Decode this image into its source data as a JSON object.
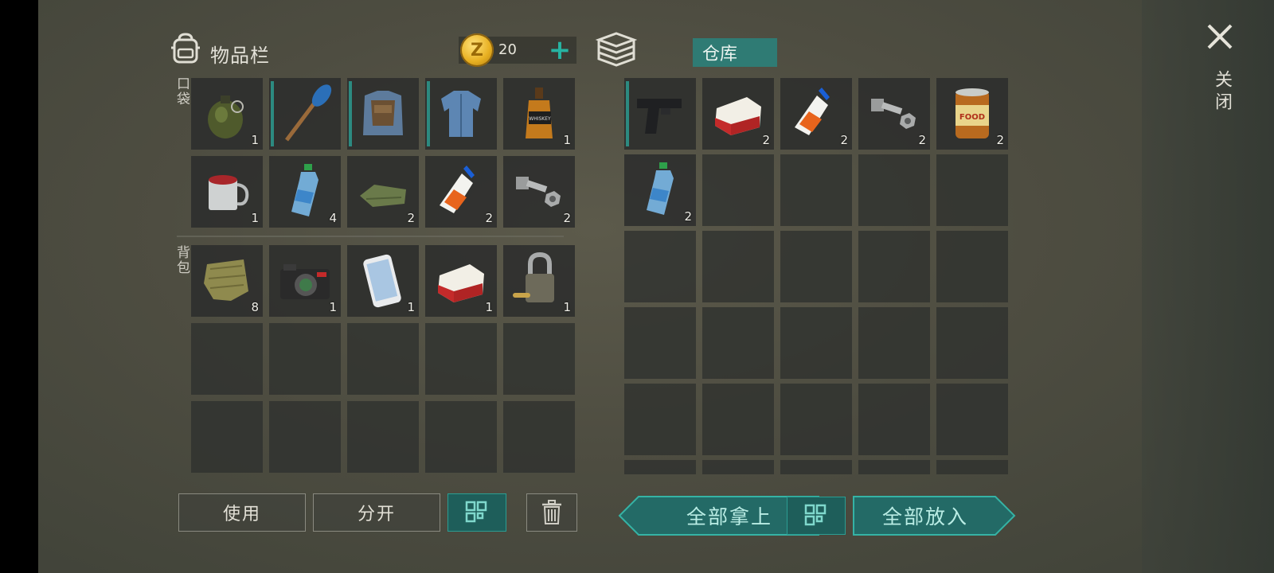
{
  "inventory": {
    "title": "物品栏",
    "coins": "20",
    "pocket_label": "口袋",
    "backpack_label": "背包",
    "pocket_slots": [
      {
        "icon": "grenade-icon",
        "count": "1"
      },
      {
        "icon": "paddle-icon",
        "count": ""
      },
      {
        "icon": "tactical-vest-icon",
        "count": ""
      },
      {
        "icon": "denim-shirt-icon",
        "count": ""
      },
      {
        "icon": "whiskey-bottle-icon",
        "count": "1"
      },
      {
        "icon": "mug-icon",
        "count": "1"
      },
      {
        "icon": "water-bottle-icon",
        "count": "4"
      },
      {
        "icon": "cloth-icon",
        "count": "2"
      },
      {
        "icon": "glue-icon",
        "count": "2"
      },
      {
        "icon": "bolt-nut-icon",
        "count": "2"
      }
    ],
    "backpack_slots": [
      {
        "icon": "rag-icon",
        "count": "8"
      },
      {
        "icon": "camera-icon",
        "count": "1"
      },
      {
        "icon": "smartphone-icon",
        "count": "1"
      },
      {
        "icon": "cigarette-pack-icon",
        "count": "1"
      },
      {
        "icon": "padlock-icon",
        "count": "1"
      }
    ],
    "buttons": {
      "use": "使用",
      "split": "分开"
    }
  },
  "warehouse": {
    "tab_label": "仓库",
    "slots": [
      {
        "icon": "pistol-icon",
        "count": ""
      },
      {
        "icon": "cigarette-pack-icon",
        "count": "2"
      },
      {
        "icon": "glue-icon",
        "count": "2"
      },
      {
        "icon": "bolt-nut-icon",
        "count": "2"
      },
      {
        "icon": "food-can-icon",
        "count": "2"
      },
      {
        "icon": "water-bottle-icon",
        "count": "2"
      }
    ],
    "buttons": {
      "take_all": "全部拿上",
      "put_all": "全部放入"
    }
  },
  "close": {
    "label": "关闭"
  },
  "colors": {
    "accent": "#27b3a2",
    "teal_button": "#236a66",
    "coin": "#e8b022"
  }
}
